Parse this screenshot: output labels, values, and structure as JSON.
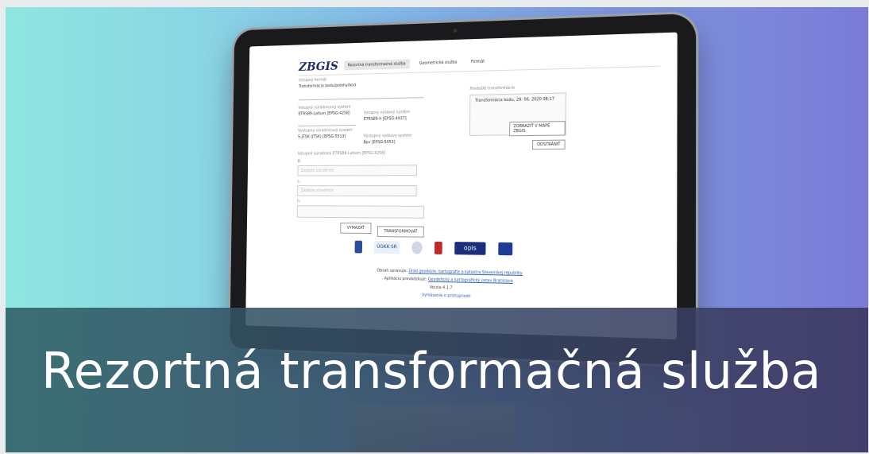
{
  "caption": "Rezortná transformačná služba",
  "screen": {
    "logo": "ZBGIS",
    "tabs": [
      "Rezortná transformačná služba",
      "Geometrická služba",
      "Formát"
    ],
    "type_label": "Vstupný formát",
    "type_value": "Transformácia bodu/polohy/bod",
    "input_system_label": "Vstupný súradnicový systém",
    "input_system_value": "ETRS89-Latlum [EPSG:4258]",
    "input_height_label": "Vstupný výškový systém",
    "input_height_value": "ETRS89-h [EPSG:4937]",
    "output_system_label": "Výstupný súradnicový systém",
    "output_system_value": "S-JTSK (JTSK) [EPSG:5513]",
    "output_height_label": "Výstupný výškový systém",
    "output_height_value": "Bpv [EPSG:5053]",
    "coords_label": "Vstupné súradnice ETRS89-Latlum [EPSG:4258]",
    "coord_b": "B:",
    "coord_l": "L:",
    "coord_h": "h:",
    "placeholder": "Zadajte súradnice",
    "clear_button": "VYMAZAŤ",
    "transform_button": "TRANSFORMOVAŤ",
    "result_label": "Predošlé transformácie",
    "result_title": "Transformácia bodu, 29. 06. 2020 08:17",
    "zoom_button": "ZOBRAZIŤ V MAPE ZBGIS",
    "delete_button": "ODSTRÁNIŤ",
    "logos": [
      "ÚGKK SR",
      "opis"
    ],
    "footer_line1_prefix": "Obsah spravuje:",
    "footer_line1_link": "Úrad geodézie, kartografie a katastra Slovenskej republiky",
    "footer_line2_prefix": "Aplikáciu prevádzkuje:",
    "footer_line2_link": "Geodetický a kartografický ústav Bratislava",
    "footer_version": "Verzia 4.1.7",
    "footer_privacy": "Vyhlásenie o prístupnosti"
  }
}
